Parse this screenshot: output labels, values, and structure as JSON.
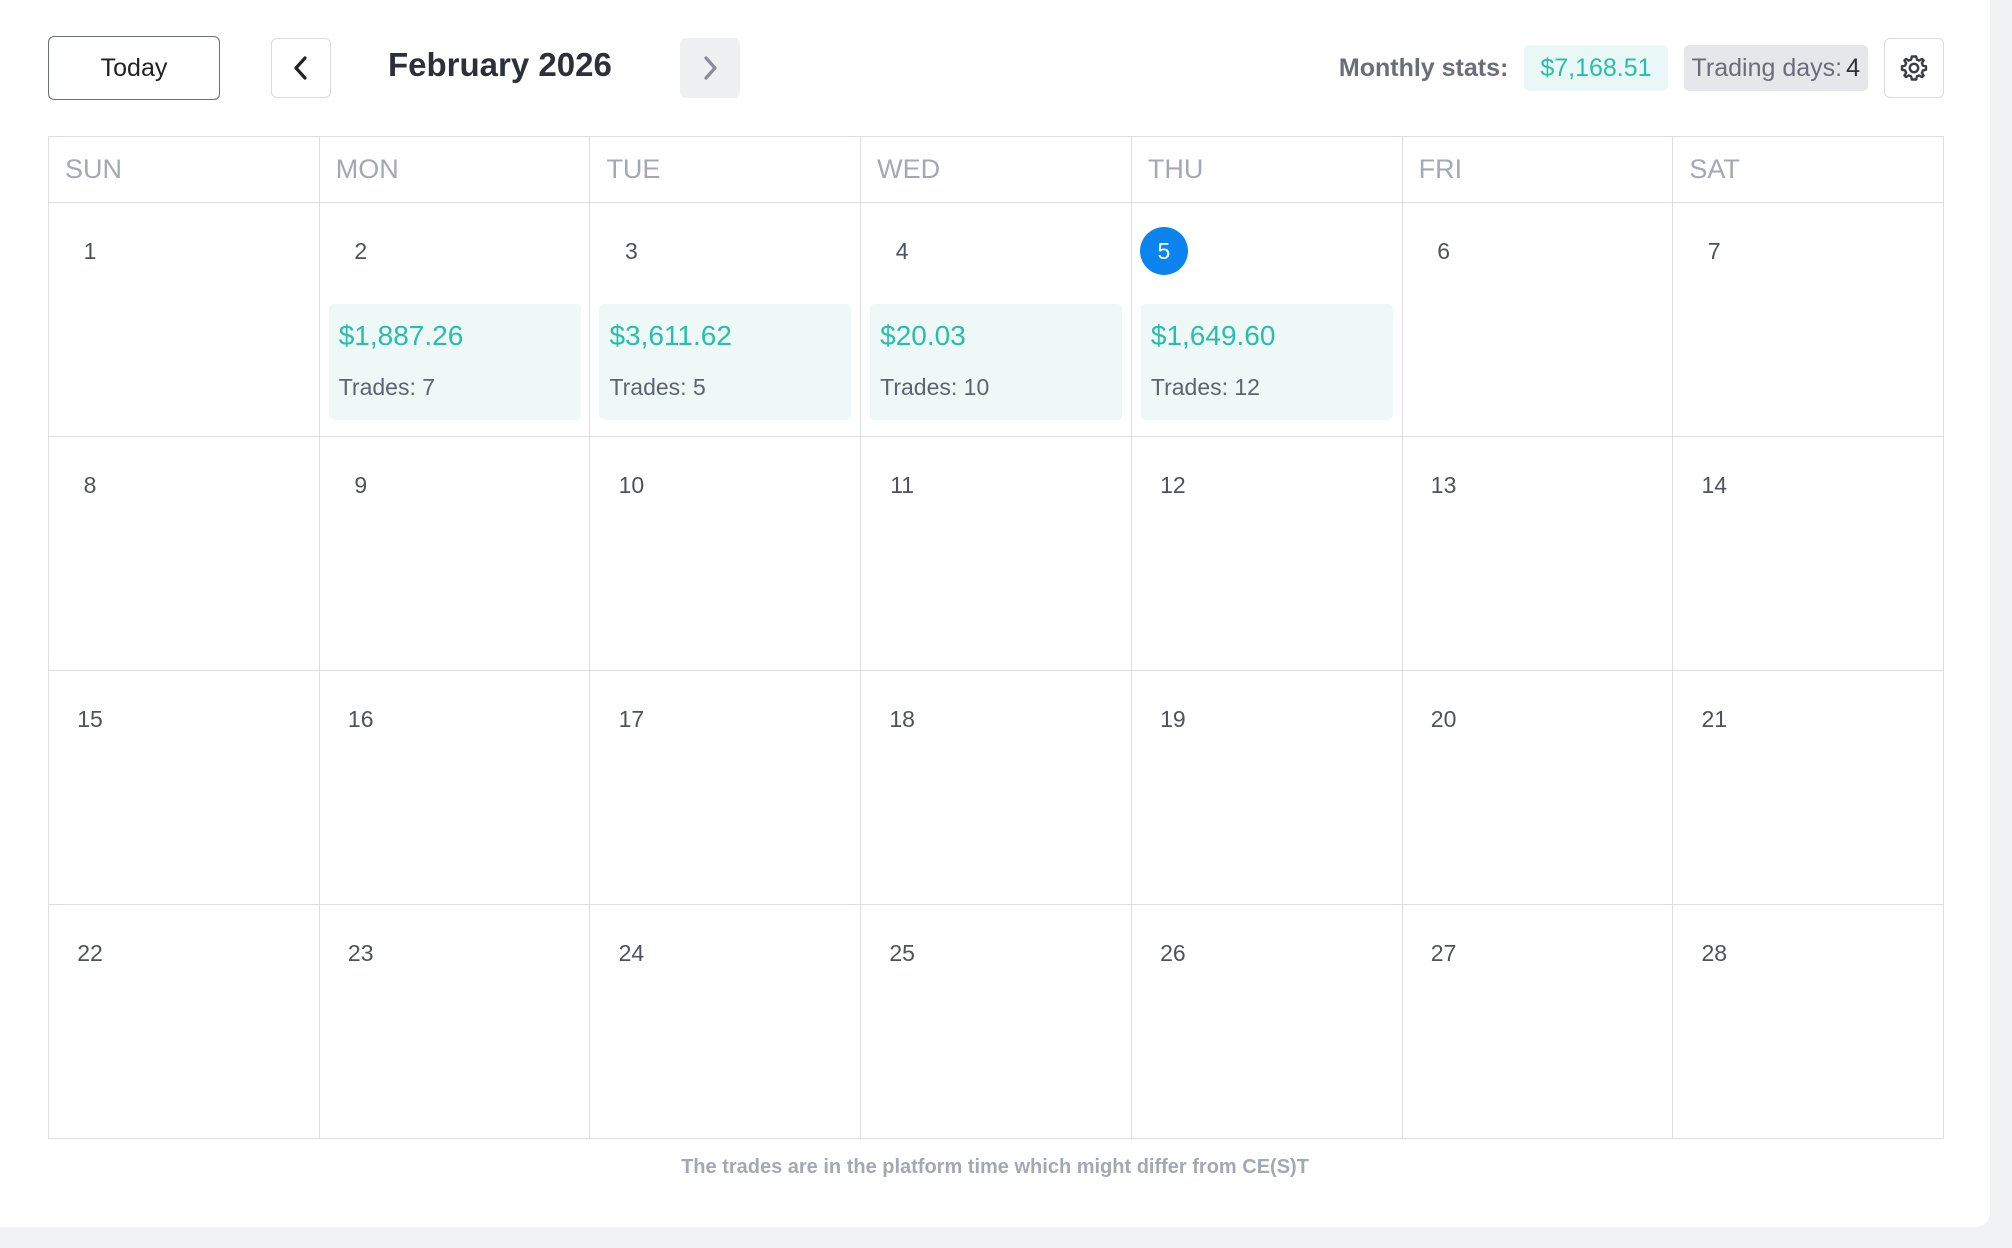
{
  "toolbar": {
    "today_label": "Today",
    "month_title": "February 2026",
    "stats_label": "Monthly stats:",
    "monthly_pnl": "$7,168.51",
    "trading_days_label": "Trading days:",
    "trading_days_value": "4"
  },
  "icons": {
    "prev": "chevron-left-icon",
    "next": "chevron-right-icon",
    "settings": "gear-icon"
  },
  "colors": {
    "profit": "#27bfa9",
    "profit_bg": "#edf8f7",
    "today_badge": "#0b84f0"
  },
  "weekdays": [
    "SUN",
    "MON",
    "TUE",
    "WED",
    "THU",
    "FRI",
    "SAT"
  ],
  "today": "5",
  "weeks": [
    [
      {
        "day": "1"
      },
      {
        "day": "2",
        "pnl": "$1,887.26",
        "trades": "Trades: 7"
      },
      {
        "day": "3",
        "pnl": "$3,611.62",
        "trades": "Trades: 5"
      },
      {
        "day": "4",
        "pnl": "$20.03",
        "trades": "Trades: 10"
      },
      {
        "day": "5",
        "pnl": "$1,649.60",
        "trades": "Trades: 12"
      },
      {
        "day": "6"
      },
      {
        "day": "7"
      }
    ],
    [
      {
        "day": "8"
      },
      {
        "day": "9"
      },
      {
        "day": "10"
      },
      {
        "day": "11"
      },
      {
        "day": "12"
      },
      {
        "day": "13"
      },
      {
        "day": "14"
      }
    ],
    [
      {
        "day": "15"
      },
      {
        "day": "16"
      },
      {
        "day": "17"
      },
      {
        "day": "18"
      },
      {
        "day": "19"
      },
      {
        "day": "20"
      },
      {
        "day": "21"
      }
    ],
    [
      {
        "day": "22"
      },
      {
        "day": "23"
      },
      {
        "day": "24"
      },
      {
        "day": "25"
      },
      {
        "day": "26"
      },
      {
        "day": "27"
      },
      {
        "day": "28"
      }
    ]
  ],
  "footnote": "The trades are in the platform time which might differ from CE(S)T"
}
